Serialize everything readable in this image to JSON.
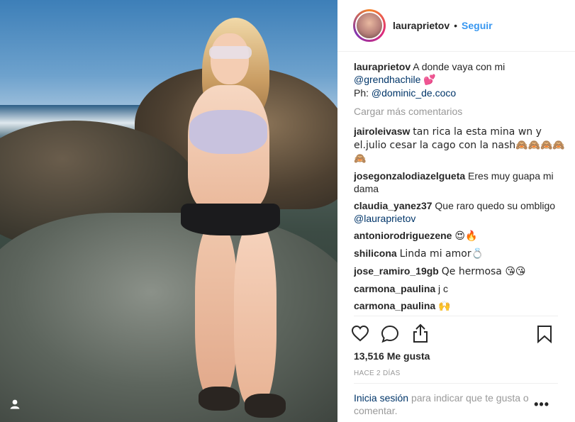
{
  "header": {
    "username": "lauraprietov",
    "separator": "•",
    "follow_label": "Seguir"
  },
  "caption": {
    "username": "lauraprietov",
    "text_1": "A donde vaya con mi",
    "mention_1": "@grendhachile",
    "emoji_1": "💕",
    "ph_label": "Ph:",
    "mention_2": "@dominic_de.coco"
  },
  "load_more": "Cargar más comentarios",
  "comments": [
    {
      "user": "jairoleivasw",
      "text": "tan rica la esta mina wn y el.julio cesar la cago con la nash🙈🙈🙈🙈🙈"
    },
    {
      "user": "josegonzalodiazelgueta",
      "text": "Eres muy guapa mi dama"
    },
    {
      "user": "claudia_yanez37",
      "text": "Que raro quedo su ombligo",
      "mention": "@lauraprietov"
    },
    {
      "user": "antoniorodriguezene",
      "text": "😍🔥"
    },
    {
      "user": "shilicona",
      "text": "Linda mi amor💍"
    },
    {
      "user": "jose_ramiro_19gb",
      "text": "Qe hermosa 😘😘"
    },
    {
      "user": "carmona_paulina",
      "text": "j c"
    },
    {
      "user": "carmona_paulina",
      "text": "🙌"
    }
  ],
  "actions": {
    "like_icon": "heart-icon",
    "comment_icon": "comment-icon",
    "share_icon": "share-icon",
    "save_icon": "bookmark-icon"
  },
  "likes": "13,516 Me gusta",
  "timestamp": "HACE 2 DÍAS",
  "login": {
    "link": "Inicia sesión",
    "text": "para indicar que te gusta o comentar."
  },
  "more_options": "•••",
  "colors": {
    "accent": "#3897f0",
    "link": "#003569",
    "muted": "#999999"
  }
}
